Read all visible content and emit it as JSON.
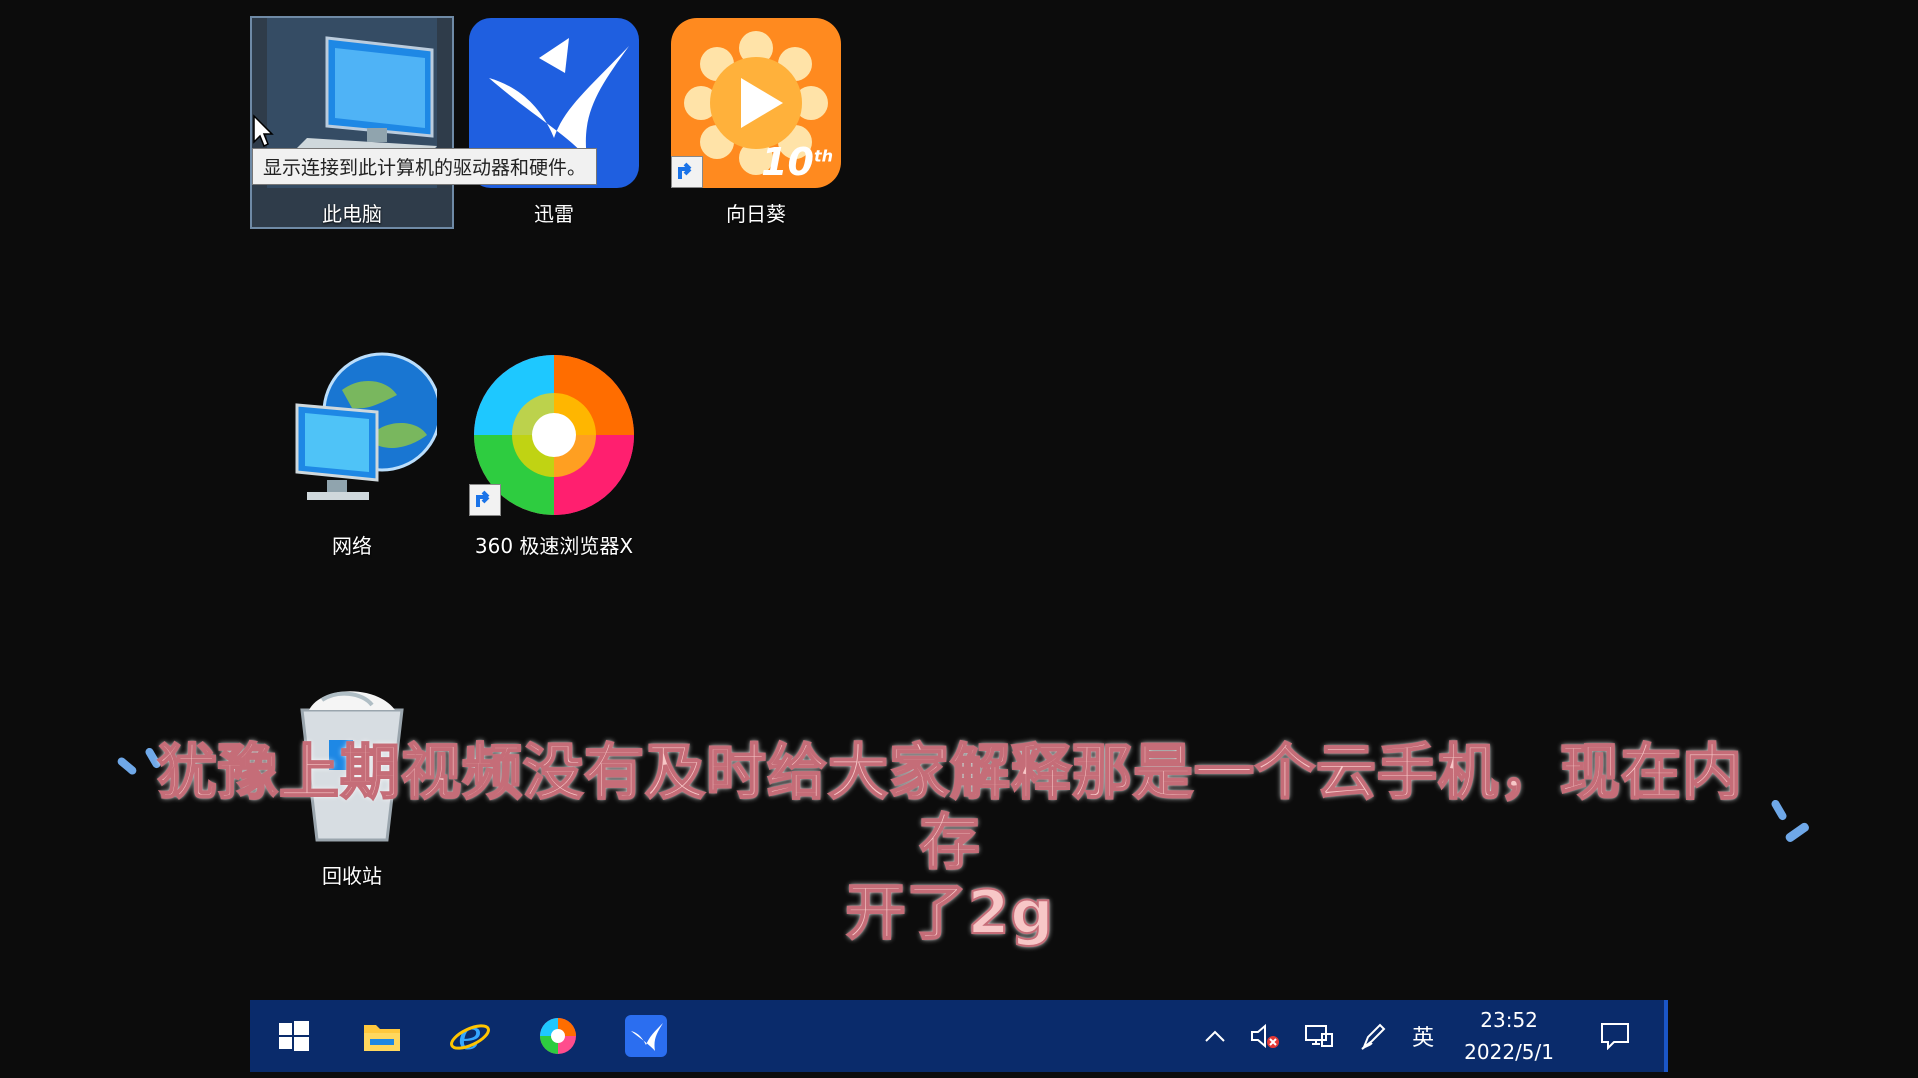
{
  "desktop": {
    "icons": [
      {
        "label": "此电脑",
        "icon": "this-pc-icon"
      },
      {
        "label": "迅雷",
        "icon": "xunlei-icon"
      },
      {
        "label": "向日葵",
        "icon": "sunflower-icon"
      },
      {
        "label": "网络",
        "icon": "network-icon"
      },
      {
        "label": "360 极速浏览器X",
        "icon": "360-browser-icon"
      },
      {
        "label": "回收站",
        "icon": "recycle-bin-icon"
      }
    ],
    "tooltip": "显示连接到此计算机的驱动器和硬件。",
    "sunflower_badge": "10",
    "sunflower_badge_sup": "th"
  },
  "subtitle": {
    "line1": "犹豫上期视频没有及时给大家解释那是一个云手机，现在内存",
    "line2": "开了2g"
  },
  "taskbar": {
    "pinned": [
      "windows-start-icon",
      "file-explorer-icon",
      "internet-explorer-icon",
      "360-browser-icon",
      "xunlei-icon"
    ],
    "tray": {
      "ime": "英",
      "time": "23:52",
      "date": "2022/5/1"
    }
  },
  "colors": {
    "taskbar": "#0a2b6b",
    "subtitle_fill": "#f7c7c7",
    "subtitle_stroke": "#c56d78"
  }
}
